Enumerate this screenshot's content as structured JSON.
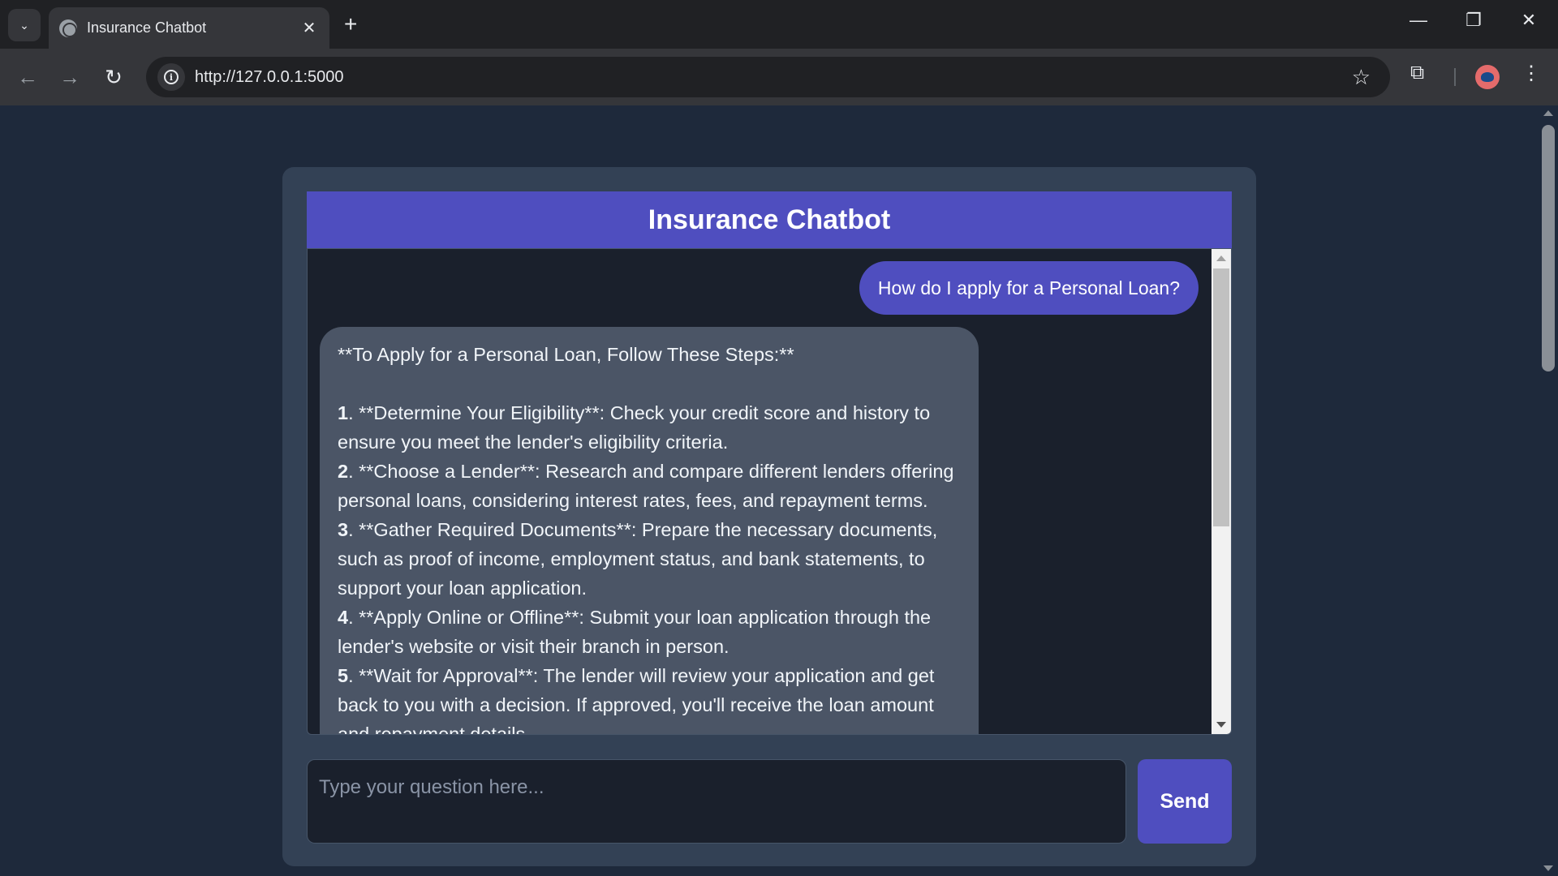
{
  "browser": {
    "tab_title": "Insurance Chatbot",
    "url": "http://127.0.0.1:5000",
    "icons": {
      "tab_search": "chevron-down-icon",
      "favicon": "globe-icon",
      "tab_close": "close-icon",
      "new_tab": "plus-icon",
      "back": "arrow-left-icon",
      "forward": "arrow-right-icon",
      "reload": "reload-icon",
      "site_info": "info-icon",
      "bookmark": "star-icon",
      "extensions": "puzzle-icon",
      "profile": "avatar",
      "menu": "kebab-menu-icon"
    },
    "glyphs": {
      "chevron": "⌄",
      "close": "✕",
      "plus": "+",
      "back": "←",
      "forward": "→",
      "reload": "↻",
      "info": "i",
      "star": "☆",
      "puzzle": "⧉",
      "menu": "⋮",
      "minimize": "—",
      "restore": "❐",
      "window_close": "✕"
    }
  },
  "chat": {
    "title": "Insurance Chatbot",
    "user_message": "How do I apply for a Personal Loan?",
    "bot_message": {
      "heading": "**To Apply for a Personal Loan, Follow These Steps:**",
      "steps": [
        {
          "num": "1",
          "text": ". **Determine Your Eligibility**: Check your credit score and history to ensure you meet the lender's eligibility criteria."
        },
        {
          "num": "2",
          "text": ". **Choose a Lender**: Research and compare different lenders offering personal loans, considering interest rates, fees, and repayment terms."
        },
        {
          "num": "3",
          "text": ". **Gather Required Documents**: Prepare the necessary documents, such as proof of income, employment status, and bank statements, to support your loan application."
        },
        {
          "num": "4",
          "text": ". **Apply Online or Offline**: Submit your loan application through the lender's website or visit their branch in person."
        },
        {
          "num": "5",
          "text": ". **Wait for Approval**: The lender will review your application and get back to you with a decision. If approved, you'll receive the loan amount and repayment details."
        }
      ]
    },
    "input": {
      "placeholder": "Type your question here...",
      "value": ""
    },
    "send_label": "Send"
  },
  "colors": {
    "page_bg": "#1e293b",
    "container_bg": "#334155",
    "accent": "#4f4ebf",
    "chat_bg": "#1a202c",
    "bot_bubble": "#4b5566"
  }
}
